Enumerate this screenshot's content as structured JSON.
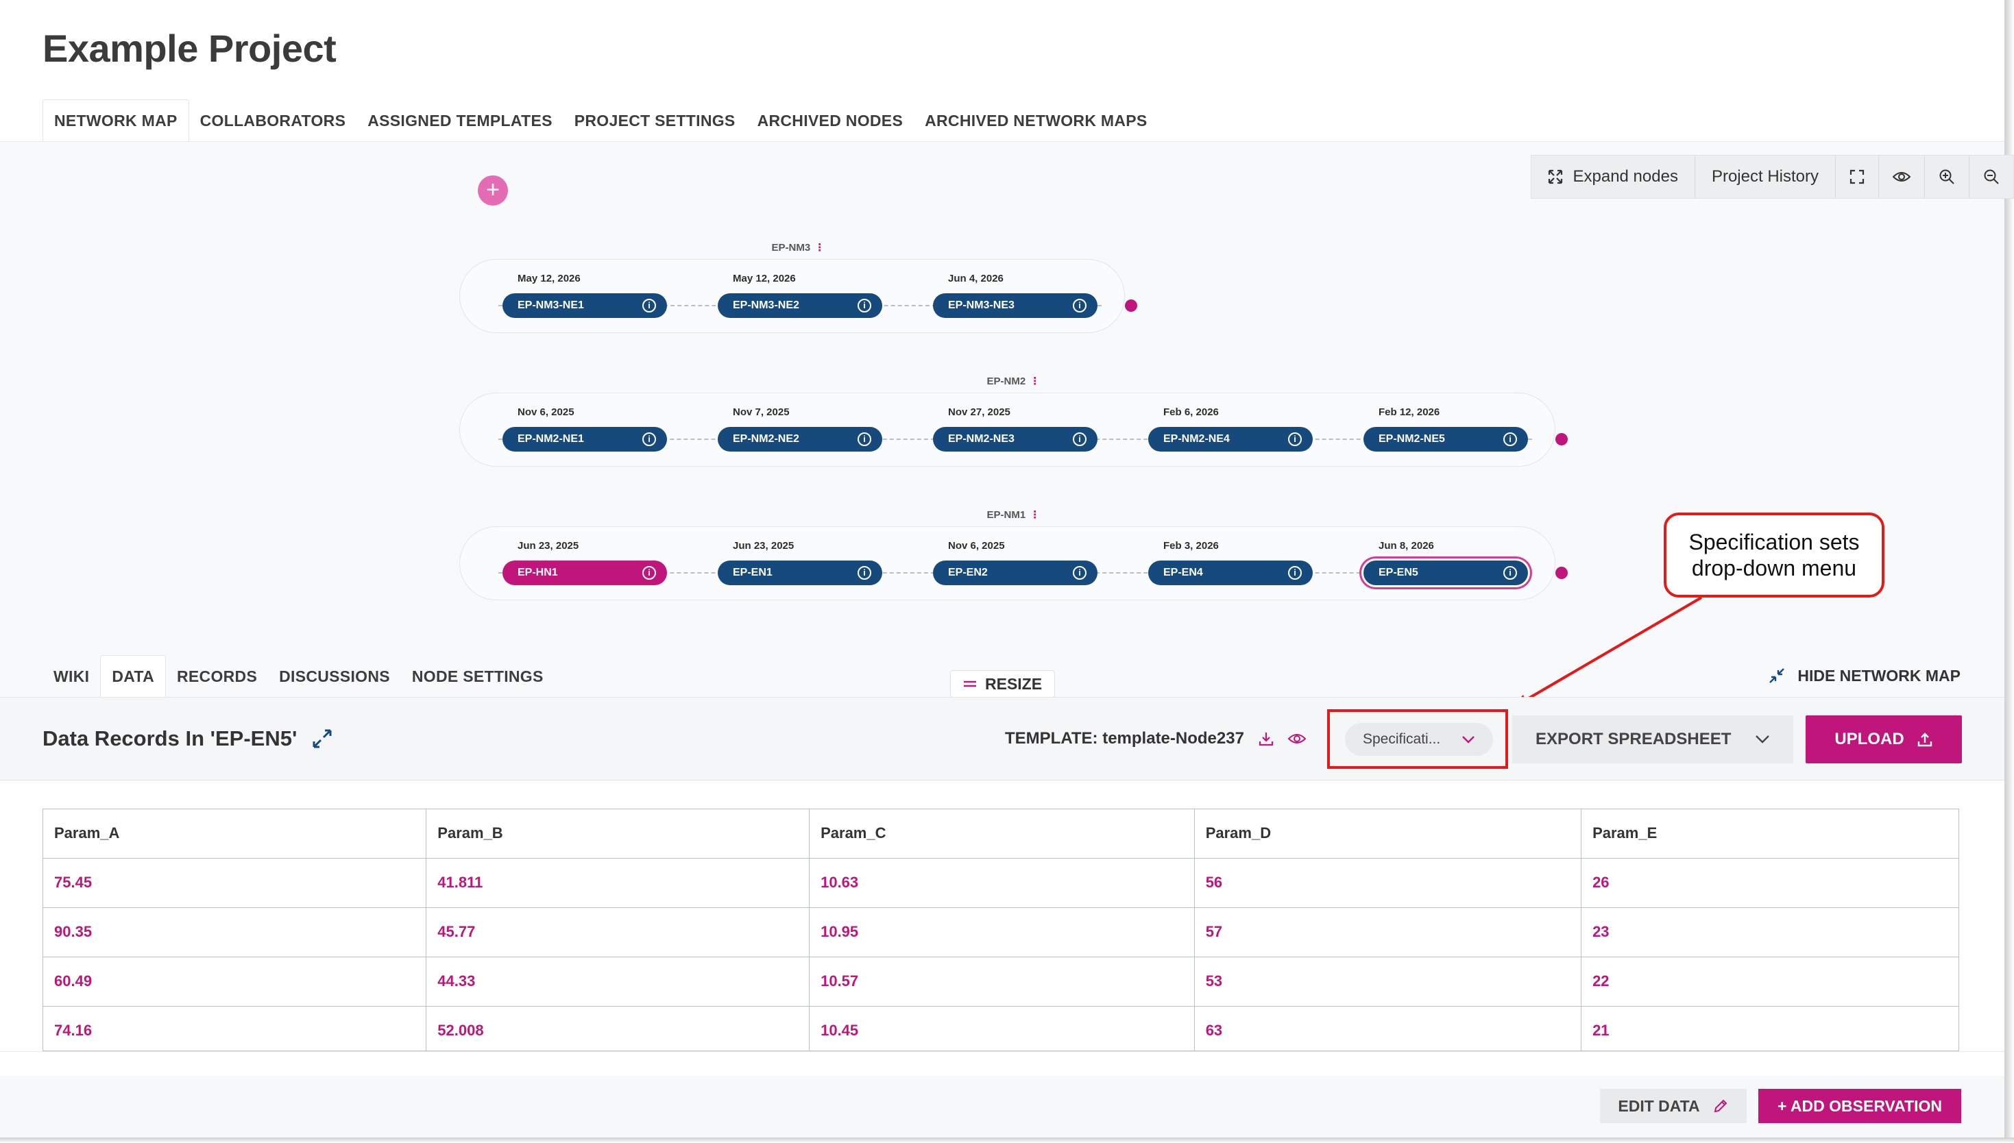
{
  "page": {
    "title": "Example Project"
  },
  "top_tabs": [
    "NETWORK MAP",
    "COLLABORATORS",
    "ASSIGNED TEMPLATES",
    "PROJECT SETTINGS",
    "ARCHIVED NODES",
    "ARCHIVED NETWORK MAPS"
  ],
  "map_toolbar": {
    "expand_label": "Expand nodes",
    "history_label": "Project History"
  },
  "add_button": "+",
  "network_maps": [
    {
      "label": "EP-NM3",
      "nodes": [
        {
          "date": "May 12, 2026",
          "name": "EP-NM3-NE1"
        },
        {
          "date": "May 12, 2026",
          "name": "EP-NM3-NE2"
        },
        {
          "date": "Jun 4, 2026",
          "name": "EP-NM3-NE3"
        }
      ]
    },
    {
      "label": "EP-NM2",
      "nodes": [
        {
          "date": "Nov 6, 2025",
          "name": "EP-NM2-NE1"
        },
        {
          "date": "Nov 7, 2025",
          "name": "EP-NM2-NE2"
        },
        {
          "date": "Nov 27, 2025",
          "name": "EP-NM2-NE3"
        },
        {
          "date": "Feb 6, 2026",
          "name": "EP-NM2-NE4"
        },
        {
          "date": "Feb 12, 2026",
          "name": "EP-NM2-NE5"
        }
      ]
    },
    {
      "label": "EP-NM1",
      "nodes": [
        {
          "date": "Jun 23, 2025",
          "name": "EP-HN1"
        },
        {
          "date": "Jun 23, 2025",
          "name": "EP-EN1"
        },
        {
          "date": "Nov 6, 2025",
          "name": "EP-EN2"
        },
        {
          "date": "Feb 3, 2026",
          "name": "EP-EN4"
        },
        {
          "date": "Jun 8, 2026",
          "name": "EP-EN5"
        }
      ]
    }
  ],
  "callout": {
    "text_line1": "Specification sets",
    "text_line2": "drop-down menu"
  },
  "lower_tabs": [
    "WIKI",
    "DATA",
    "RECORDS",
    "DISCUSSIONS",
    "NODE SETTINGS"
  ],
  "resize_label": "RESIZE",
  "hide_map_label": "HIDE NETWORK MAP",
  "data_section": {
    "title": "Data Records In 'EP-EN5'",
    "template_label": "TEMPLATE: template-Node237",
    "spec_select_value": "Specificati...",
    "export_label": "EXPORT SPREADSHEET",
    "upload_label": "UPLOAD"
  },
  "table": {
    "columns": [
      "Param_A",
      "Param_B",
      "Param_C",
      "Param_D",
      "Param_E"
    ],
    "rows": [
      [
        "75.45",
        "41.811",
        "10.63",
        "56",
        "26"
      ],
      [
        "90.35",
        "45.77",
        "10.95",
        "57",
        "23"
      ],
      [
        "60.49",
        "44.33",
        "10.57",
        "53",
        "22"
      ],
      [
        "74.16",
        "52.008",
        "10.45",
        "63",
        "21"
      ]
    ]
  },
  "bottom_actions": {
    "edit_label": "EDIT DATA",
    "add_label": "+ ADD OBSERVATION"
  },
  "colors": {
    "accent": "#c0157a",
    "node": "#174a7c",
    "callout": "#e21a1a"
  },
  "icons": [
    "expand-icon",
    "fullscreen-icon",
    "eye-icon",
    "zoom-in-icon",
    "zoom-out-icon",
    "info-icon",
    "download-icon",
    "chevron-down-icon",
    "upload-icon",
    "pencil-icon",
    "collapse-icon",
    "resize-icon"
  ]
}
